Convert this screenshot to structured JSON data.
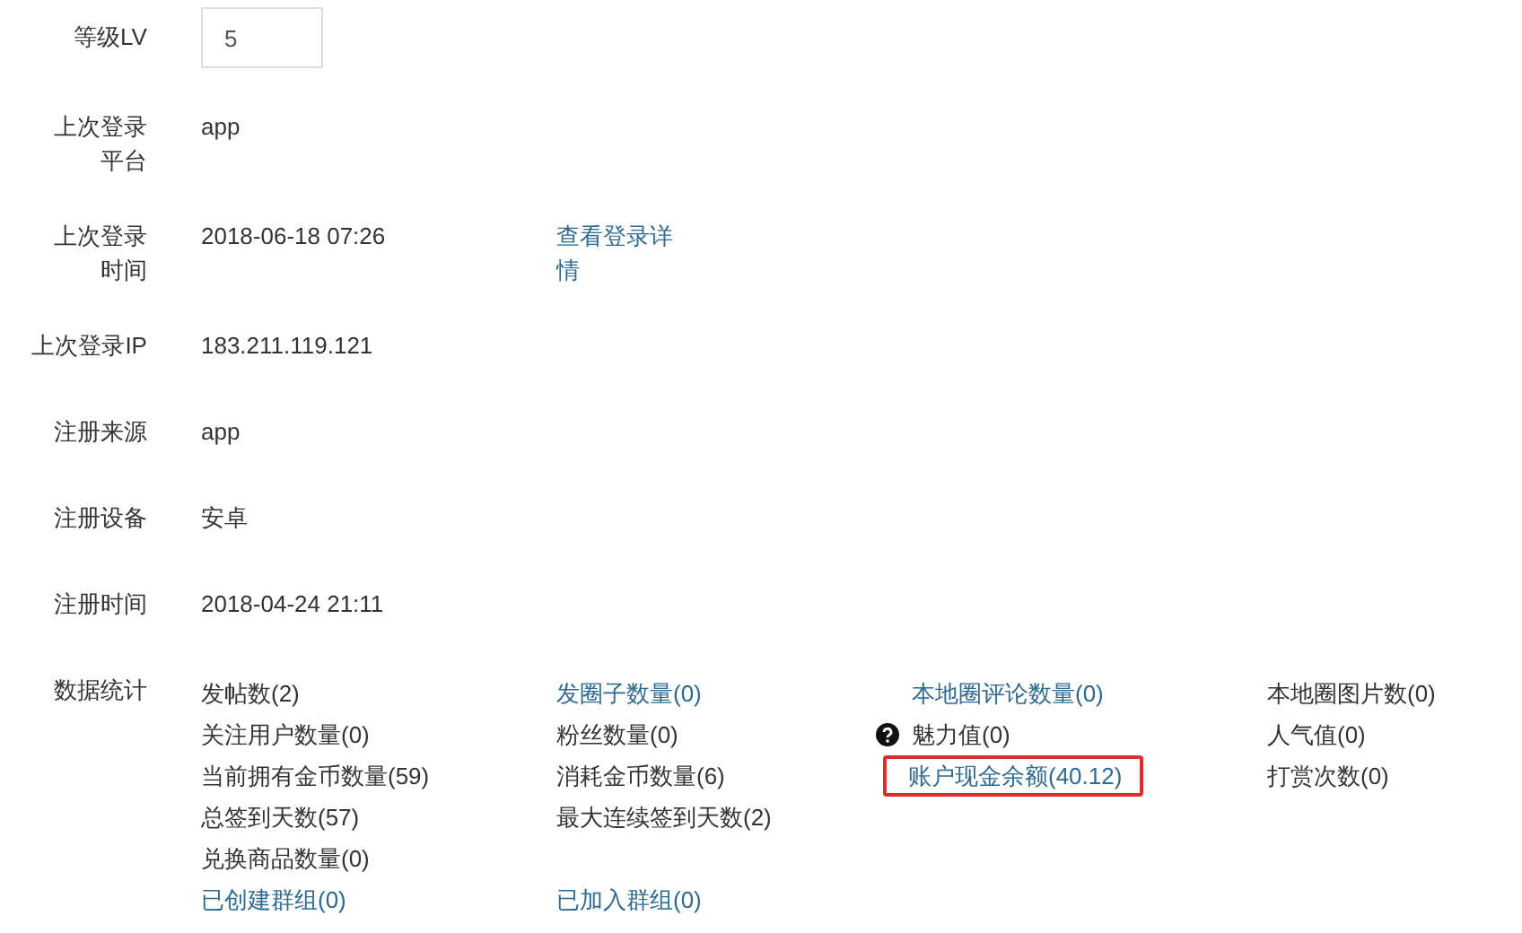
{
  "fields": [
    {
      "label": "等级LV",
      "kind": "input",
      "value": "5"
    },
    {
      "label": "上次登录平台",
      "kind": "text",
      "value": "app"
    },
    {
      "label": "上次登录时间",
      "kind": "text",
      "value": "2018-06-18 07:26",
      "link": "查看登录详情"
    },
    {
      "label": "上次登录IP",
      "kind": "text",
      "value": "183.211.119.121"
    },
    {
      "label": "注册来源",
      "kind": "text",
      "value": "app"
    },
    {
      "label": "注册设备",
      "kind": "text",
      "value": "安卓"
    },
    {
      "label": "注册时间",
      "kind": "text",
      "value": "2018-04-24 21:11"
    }
  ],
  "stats": {
    "label": "数据统计",
    "rows": [
      [
        {
          "text": "发帖数(2)",
          "kind": "text"
        },
        {
          "text": "发圈子数量(0)",
          "kind": "link"
        },
        {
          "text": "本地圈评论数量(0)",
          "kind": "link"
        },
        {
          "text": "本地圈图片数(0)",
          "kind": "text"
        }
      ],
      [
        {
          "text": "关注用户数量(0)",
          "kind": "text"
        },
        {
          "text": "粉丝数量(0)",
          "kind": "text"
        },
        {
          "text": "魅力值(0)",
          "kind": "text",
          "help_icon": true
        },
        {
          "text": "人气值(0)",
          "kind": "text"
        }
      ],
      [
        {
          "text": "当前拥有金币数量(59)",
          "kind": "text"
        },
        {
          "text": "消耗金币数量(6)",
          "kind": "text"
        },
        {
          "text": "账户现金余额(40.12)",
          "kind": "link",
          "highlighted": true
        },
        {
          "text": "打赏次数(0)",
          "kind": "text"
        }
      ],
      [
        {
          "text": "总签到天数(57)",
          "kind": "text"
        },
        {
          "text": "最大连续签到天数(2)",
          "kind": "text"
        }
      ],
      [
        {
          "text": "兑换商品数量(0)",
          "kind": "text"
        }
      ],
      [
        {
          "text": "已创建群组(0)",
          "kind": "link"
        },
        {
          "text": "已加入群组(0)",
          "kind": "link"
        }
      ]
    ]
  }
}
